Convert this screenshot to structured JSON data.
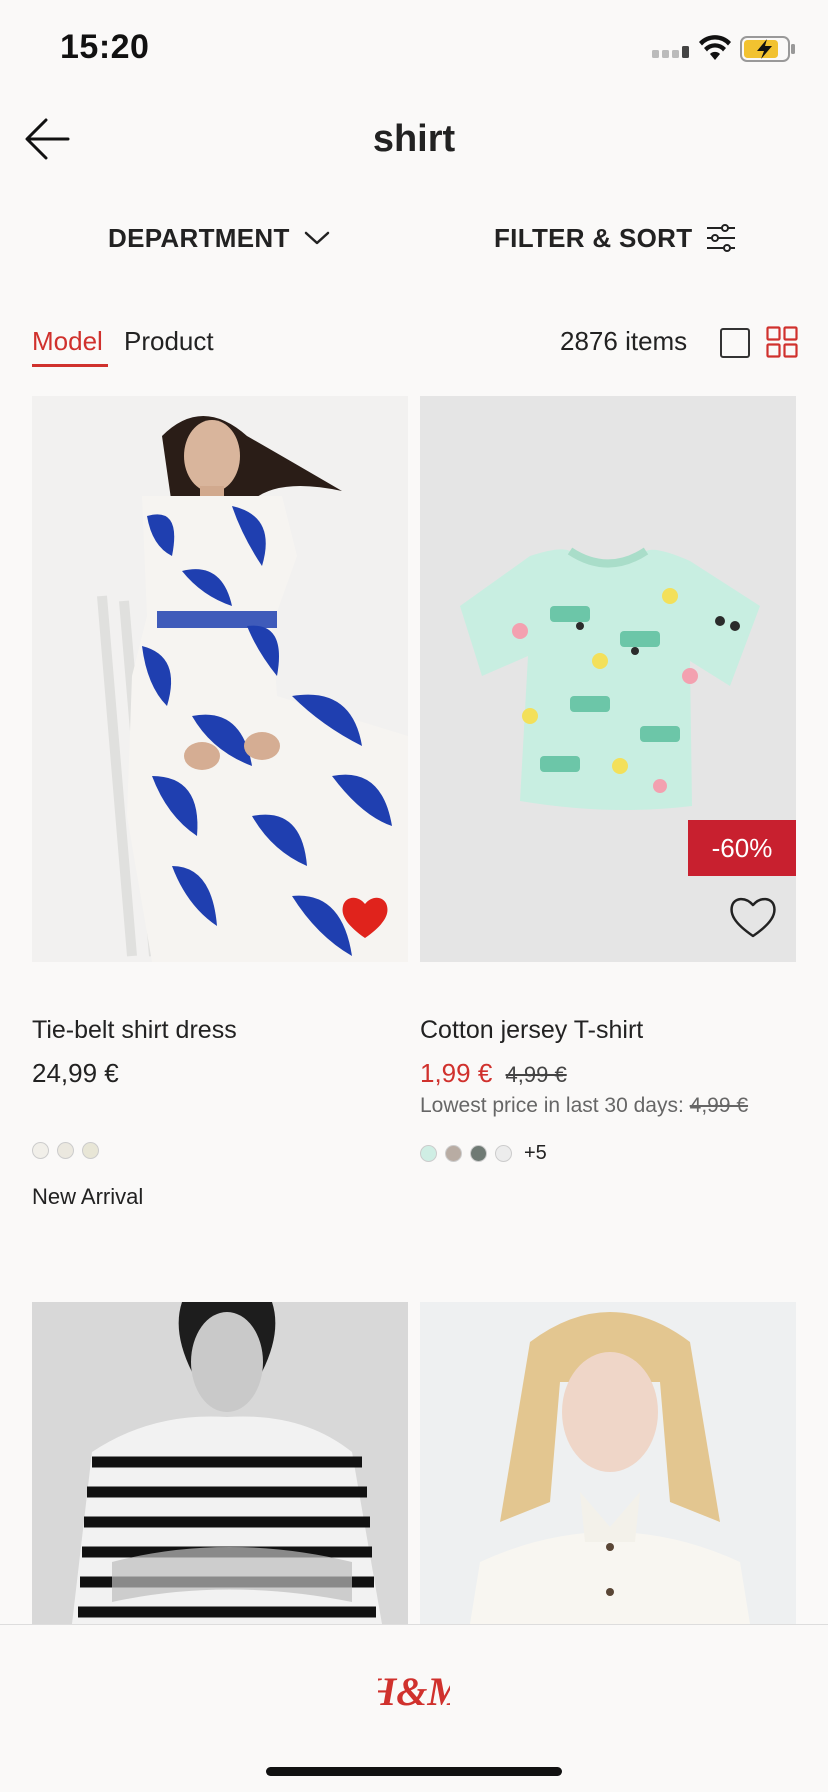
{
  "status_bar": {
    "time": "15:20"
  },
  "header": {
    "title": "shirt"
  },
  "filters": {
    "department": "DEPARTMENT",
    "filter_sort": "FILTER & SORT"
  },
  "tabs": {
    "model": "Model",
    "product": "Product",
    "item_count": "2876 items"
  },
  "products": [
    {
      "name": "Tie-belt shirt dress",
      "price": "24,99 €",
      "swatches": [
        "#f1efe9",
        "#ebe8df",
        "#e8e6d6"
      ],
      "badge": "New Arrival",
      "favorited": true
    },
    {
      "name": "Cotton jersey T-shirt",
      "price": "1,99 €",
      "old_price": "4,99 €",
      "lowest_label": "Lowest price in last 30 days:",
      "lowest_value": "4,99 €",
      "discount": "-60%",
      "swatches": [
        "#cfeee4",
        "#b8aca3",
        "#6f7a74",
        "#ececec"
      ],
      "more_colors": "+5",
      "favorited": false
    }
  ],
  "brand": {
    "logo_text": "H&M"
  },
  "colors": {
    "accent": "#d0312d",
    "discount_bg": "#c8202f",
    "background": "#faf9f8"
  }
}
